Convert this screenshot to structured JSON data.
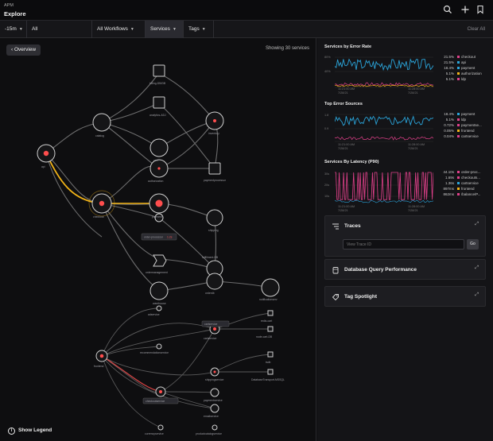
{
  "header": {
    "app": "APM",
    "title": "Explore"
  },
  "filters": {
    "time": "-15m",
    "environment": "All Environments",
    "workflows": "All Workflows",
    "services": "Services",
    "tags": "Tags",
    "clear_all": "Clear All"
  },
  "map": {
    "overview_label": "Overview",
    "showing": "Showing 30 services",
    "legend_label": "Show Legend",
    "nodes_top": [
      {
        "label": "api"
      },
      {
        "label": "catalog"
      },
      {
        "label": "checkout"
      },
      {
        "label": "billing-DB/DB"
      },
      {
        "label": "analytics-ADJ"
      },
      {
        "label": "cart"
      },
      {
        "label": "authorization"
      },
      {
        "label": "payment"
      },
      {
        "label": "inventory"
      },
      {
        "label": "paymentprocessor"
      },
      {
        "label": "shipping"
      },
      {
        "label": "ordermanagement"
      },
      {
        "label": "fulfillment-DB"
      },
      {
        "label": "orderdb"
      },
      {
        "label": "warehouse"
      },
      {
        "label": "notificationserv"
      }
    ],
    "nodes_bottom": [
      {
        "label": "frontend"
      },
      {
        "label": "adservice"
      },
      {
        "label": "cartservice"
      },
      {
        "label": "checkoutservice"
      },
      {
        "label": "shippingservice"
      },
      {
        "label": "paymentservice"
      },
      {
        "label": "emailservice"
      },
      {
        "label": "productcatalogservice"
      },
      {
        "label": "currencyservice"
      },
      {
        "label": "recommendationservice"
      },
      {
        "label": "redis-cart"
      },
      {
        "label": "tsdb"
      },
      {
        "label": "node-cart-DB"
      },
      {
        "label": "DatabaseTransport-MSSQL"
      }
    ],
    "badge_1": "order-processor",
    "badge_1_val": "1.2s",
    "badge_2": "cartservice",
    "badge_3": "checkoutservice"
  },
  "colors": {
    "accent_red": "#ff4d4d",
    "accent_yellow": "#f2b418",
    "series_blue": "#2aa3d8",
    "series_pink": "#e0408a"
  },
  "panels": {
    "error_rate": {
      "title": "Services by Error Rate",
      "ticks_y": [
        "80%",
        "40%"
      ],
      "ticks_x": [
        "11:21:00 AM",
        "11:28:00 AM"
      ],
      "ticks_x_sub": [
        "7/28/21",
        "7/28/21"
      ],
      "legend": [
        {
          "value": "21.5%",
          "name": "checkout",
          "color": "#e0408a"
        },
        {
          "value": "21.5%",
          "name": "api",
          "color": "#2aa3d8"
        },
        {
          "value": "18.4%",
          "name": "payment",
          "color": "#2aa3d8"
        },
        {
          "value": "5.1%",
          "name": "authorization",
          "color": "#f2b418"
        },
        {
          "value": "5.1%",
          "name": "ldp",
          "color": "#e0408a"
        }
      ]
    },
    "error_sources": {
      "title": "Top Error Sources",
      "ticks_y": [
        "1.8",
        "0.9"
      ],
      "ticks_x": [
        "11:21:00 AM",
        "11:28:00 AM"
      ],
      "ticks_x_sub": [
        "7/28/21",
        "7/28/21"
      ],
      "legend": [
        {
          "value": "18.4%",
          "name": "payment",
          "color": "#2aa3d8"
        },
        {
          "value": "5.1%",
          "name": "ldp",
          "color": "#e0408a"
        },
        {
          "value": "0.72%",
          "name": "paymentse...",
          "color": "#e0408a"
        },
        {
          "value": "0.05%",
          "name": "frontend",
          "color": "#f2b418"
        },
        {
          "value": "0.04%",
          "name": "cartservice",
          "color": "#e0408a"
        }
      ]
    },
    "latency": {
      "title": "Services By Latency (P90)",
      "ticks_y": [
        "30s",
        "20s",
        "10s"
      ],
      "ticks_x": [
        "11:21:00 AM",
        "11:28:00 AM"
      ],
      "ticks_x_sub": [
        "7/28/21",
        "7/28/21"
      ],
      "legend": [
        {
          "value": "44.10s",
          "name": "order-proc...",
          "color": "#e0408a"
        },
        {
          "value": "1.69s",
          "name": "checkouts...",
          "color": "#e0408a"
        },
        {
          "value": "1.36s",
          "name": "cartservice",
          "color": "#2aa3d8"
        },
        {
          "value": "897ms",
          "name": "frontend",
          "color": "#f2b418"
        },
        {
          "value": "862ms",
          "name": "/balance/P...",
          "color": "#e0408a"
        }
      ]
    },
    "traces": {
      "title": "Traces",
      "placeholder": "View Trace ID",
      "go": "Go"
    },
    "db": {
      "title": "Database Query Performance"
    },
    "tag": {
      "title": "Tag Spotlight"
    }
  }
}
